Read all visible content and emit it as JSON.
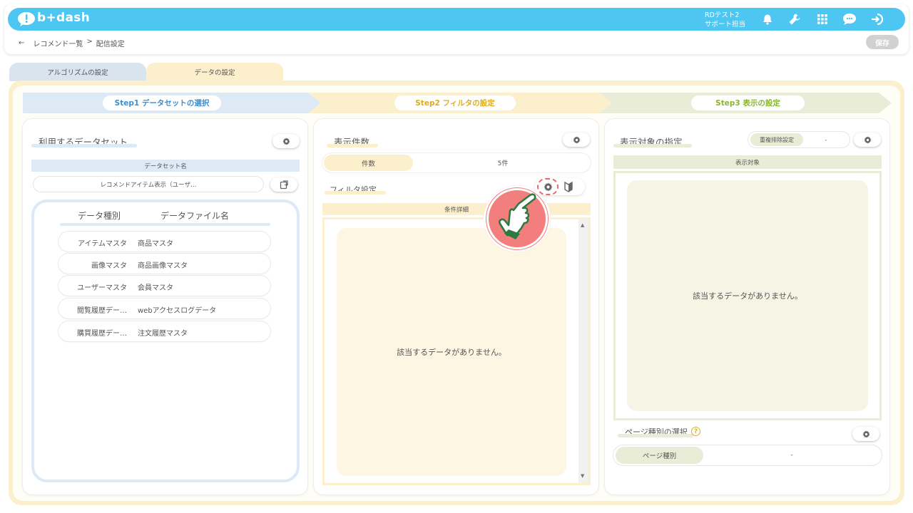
{
  "app": {
    "logo": "b+dash"
  },
  "header": {
    "user_name": "RDテスト2",
    "user_role": "サポート担当",
    "icons": [
      "bell-icon",
      "wrench-icon",
      "grid-icon",
      "chat-icon",
      "logout-icon"
    ]
  },
  "breadcrumb": {
    "back": "←",
    "parent": "レコメンド一覧",
    "sep": ">",
    "current": "配信設定"
  },
  "toolbar": {
    "save_label": "保存"
  },
  "tabs": [
    {
      "label": "アルゴリズムの設定"
    },
    {
      "label": "データの設定"
    }
  ],
  "steps": [
    {
      "label": "Step1 データセットの選択",
      "color": "#3b8fd0"
    },
    {
      "label": "Step2 フィルタの設定",
      "color": "#e0ac1b"
    },
    {
      "label": "Step3 表示の設定",
      "color": "#8ab530"
    }
  ],
  "dataset_panel": {
    "title": "利用するデータセット",
    "name_header": "データセット名",
    "name_value": "レコメンドアイテム表示（ユーザ…",
    "col_type": "データ種別",
    "col_file": "データファイル名",
    "rows": [
      {
        "type": "アイテムマスタ",
        "file": "商品マスタ"
      },
      {
        "type": "画像マスタ",
        "file": "商品画像マスタ"
      },
      {
        "type": "ユーザーマスタ",
        "file": "会員マスタ"
      },
      {
        "type": "閲覧履歴デー…",
        "file": "webアクセスログデータ"
      },
      {
        "type": "購買履歴デー…",
        "file": "注文履歴マスタ"
      }
    ]
  },
  "filter_panel": {
    "title": "表示件数",
    "count_label": "件数",
    "count_value": "5件",
    "filter_title": "フィルタ設定",
    "cond_header": "条件詳細",
    "empty": "該当するデータがありません。"
  },
  "display_panel": {
    "title": "表示対象の指定",
    "dedup_label": "重複排除設定",
    "dedup_value": "-",
    "target_header": "表示対象",
    "empty": "該当するデータがありません。",
    "page_title": "ページ種別の選択",
    "page_label": "ページ種別",
    "page_value": "-"
  },
  "colors": {
    "header": "#4dc6f2",
    "blue_light": "#deebf6",
    "yellow_light": "#fcefcc",
    "green_light": "#e8ecd6",
    "hand_badge": "#f07a7a"
  }
}
